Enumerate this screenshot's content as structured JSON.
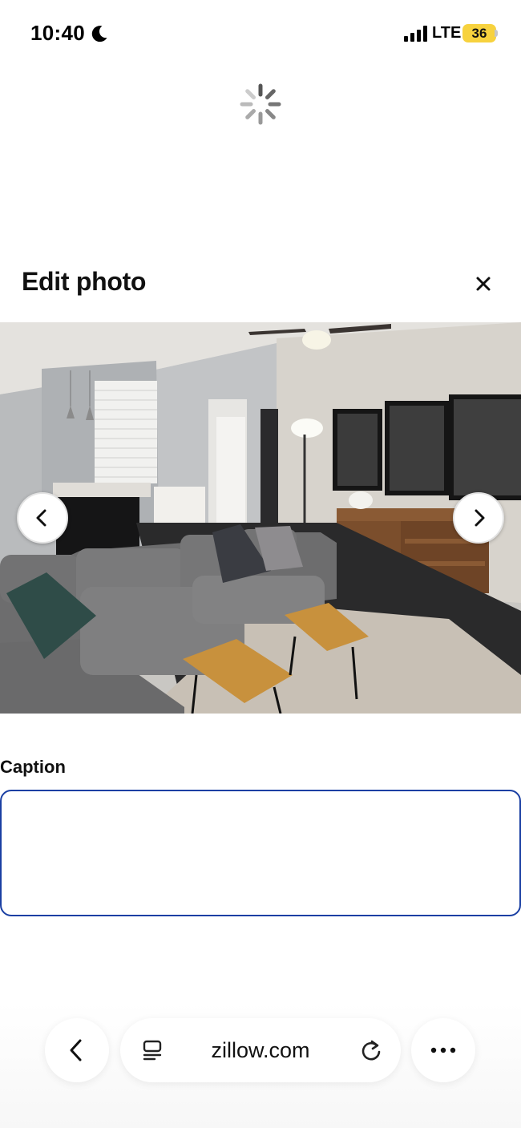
{
  "status_bar": {
    "time": "10:40",
    "network": "LTE",
    "battery": "36",
    "icons": [
      "moon-icon",
      "signal-icon",
      "battery-icon"
    ],
    "battery_color": "#f7d23e"
  },
  "loading": {
    "icon": "spinner-icon"
  },
  "dialog": {
    "title": "Edit photo",
    "close_icon": "close-icon"
  },
  "photo": {
    "prev_icon": "chevron-left-icon",
    "next_icon": "chevron-right-icon"
  },
  "caption": {
    "label": "Caption",
    "value": "",
    "placeholder": ""
  },
  "browser_bar": {
    "url": "zillow.com",
    "back_icon": "chevron-left-icon",
    "reader_icon": "reader-icon",
    "reload_icon": "reload-icon",
    "more_icon": "more-icon"
  },
  "colors": {
    "caption_border": "#1a3fa3",
    "text": "#111111"
  }
}
